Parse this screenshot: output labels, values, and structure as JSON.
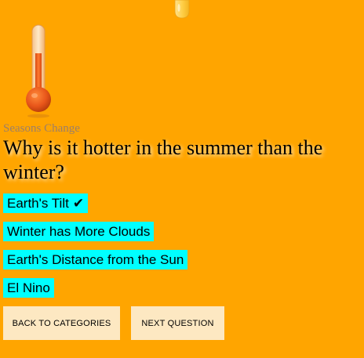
{
  "quiz": {
    "category": "Seasons Change",
    "question": "Why is it hotter in the summer than the winter?",
    "answers": [
      {
        "label": "Earth's Tilt",
        "selected_mark": "✔"
      },
      {
        "label": "Winter has More Clouds"
      },
      {
        "label": "Earth's Distance from the Sun"
      },
      {
        "label": "El Nino"
      }
    ]
  },
  "buttons": {
    "back_label": "BACK TO CATEGORIES",
    "next_label": "NEXT QUESTION"
  },
  "colors": {
    "background": "#ffa500",
    "answer_bg": "#00ffff",
    "button_bg": "#fde8c2",
    "thermometer_fill": "#e8561a"
  },
  "icons": {
    "category": "thermometer-icon",
    "decoration": "droplet-icon"
  }
}
